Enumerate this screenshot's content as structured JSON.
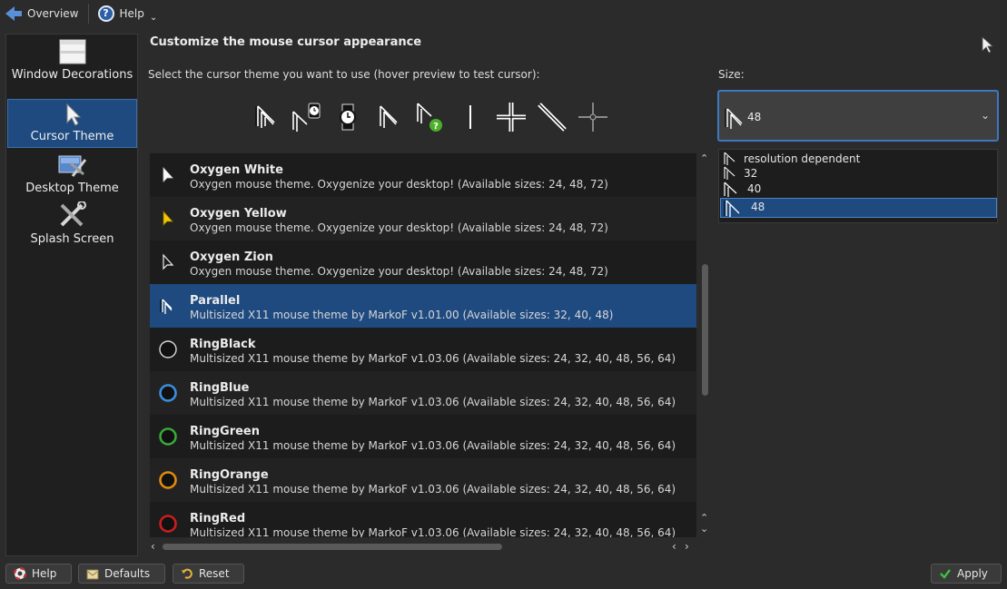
{
  "toolbar": {
    "overview_label": "Overview",
    "help_label": "Help"
  },
  "sidebar": {
    "items": [
      {
        "label": "Window Decorations"
      },
      {
        "label": "Cursor Theme"
      },
      {
        "label": "Desktop Theme"
      },
      {
        "label": "Splash Screen"
      }
    ]
  },
  "main": {
    "title": "Customize the mouse cursor appearance",
    "instruction": "Select the cursor theme you want to use (hover preview to test cursor):",
    "themes": [
      {
        "name": "Oxygen White",
        "description": "Oxygen mouse theme. Oxygenize your desktop! (Available sizes: 24, 48, 72)"
      },
      {
        "name": "Oxygen Yellow",
        "description": "Oxygen mouse theme. Oxygenize your desktop! (Available sizes: 24, 48, 72)"
      },
      {
        "name": "Oxygen Zion",
        "description": "Oxygen mouse theme. Oxygenize your desktop! (Available sizes: 24, 48, 72)"
      },
      {
        "name": "Parallel",
        "description": "Multisized X11 mouse theme by MarkoF v1.01.00 (Available sizes: 32, 40, 48)"
      },
      {
        "name": "RingBlack",
        "description": "Multisized X11 mouse theme by MarkoF v1.03.06 (Available sizes: 24, 32, 40, 48, 56, 64)"
      },
      {
        "name": "RingBlue",
        "description": "Multisized X11 mouse theme by MarkoF v1.03.06 (Available sizes: 24, 32, 40, 48, 56, 64)"
      },
      {
        "name": "RingGreen",
        "description": "Multisized X11 mouse theme by MarkoF v1.03.06 (Available sizes: 24, 32, 40, 48, 56, 64)"
      },
      {
        "name": "RingOrange",
        "description": "Multisized X11 mouse theme by MarkoF v1.03.06 (Available sizes: 24, 32, 40, 48, 56, 64)"
      },
      {
        "name": "RingRed",
        "description": "Multisized X11 mouse theme by MarkoF v1.03.06 (Available sizes: 24, 32, 40, 48, 56, 64)"
      }
    ],
    "selected_theme": "Parallel"
  },
  "size": {
    "label": "Size:",
    "current": "48",
    "options": [
      "resolution dependent",
      "32",
      "40",
      "48"
    ]
  },
  "buttons": {
    "help": "Help",
    "defaults": "Defaults",
    "reset": "Reset",
    "apply": "Apply"
  },
  "colors": {
    "selection": "#1e4a80",
    "accent": "#3e78c0",
    "ring_blue": "#3b8ee0",
    "ring_green": "#3aa838",
    "ring_orange": "#e08a10",
    "ring_red": "#c81e1e",
    "oxygen_yellow": "#f2c800"
  }
}
